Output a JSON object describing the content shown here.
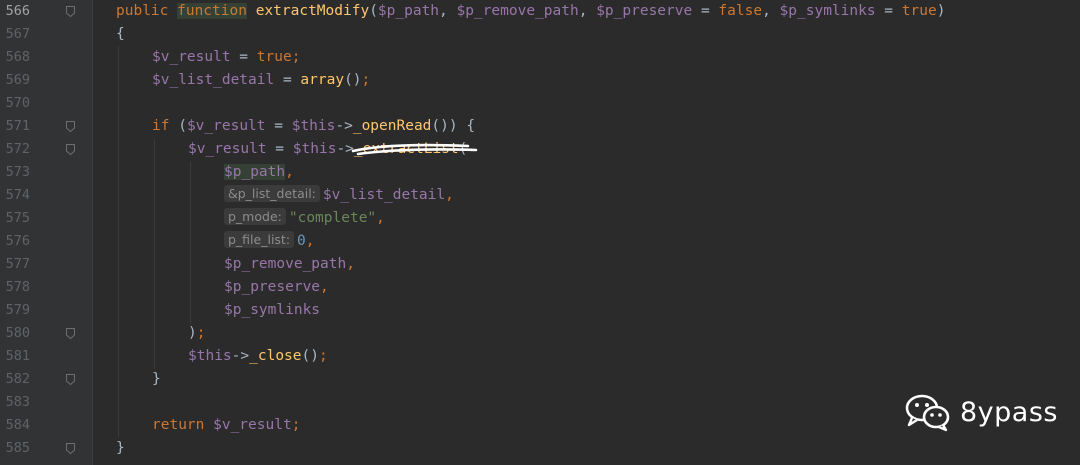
{
  "editor": {
    "lines": [
      {
        "no": "566",
        "current": true,
        "fold": true,
        "tokens": [
          [
            "kw",
            "public "
          ],
          [
            "kw hl",
            "function"
          ],
          [
            "pl",
            " "
          ],
          [
            "fn",
            "extractModify"
          ],
          [
            "pl",
            "("
          ],
          [
            "var",
            "$p_path"
          ],
          [
            "pl",
            ", "
          ],
          [
            "var",
            "$p_remove_path"
          ],
          [
            "pl",
            ", "
          ],
          [
            "var",
            "$p_preserve"
          ],
          [
            "pl",
            " = "
          ],
          [
            "kw",
            "false"
          ],
          [
            "pl",
            ", "
          ],
          [
            "var",
            "$p_symlinks"
          ],
          [
            "pl",
            " = "
          ],
          [
            "kw",
            "true"
          ],
          [
            "pl",
            ")"
          ]
        ],
        "indent": 0
      },
      {
        "no": "567",
        "tokens": [
          [
            "pl",
            "{"
          ]
        ],
        "indent": 0
      },
      {
        "no": "568",
        "tokens": [
          [
            "var",
            "$v_result"
          ],
          [
            "pl",
            " = "
          ],
          [
            "kw",
            "true"
          ],
          [
            "kw",
            ";"
          ]
        ],
        "indent": 1
      },
      {
        "no": "569",
        "tokens": [
          [
            "var",
            "$v_list_detail"
          ],
          [
            "pl",
            " = "
          ],
          [
            "fn",
            "array"
          ],
          [
            "pl",
            "()"
          ],
          [
            "kw",
            ";"
          ]
        ],
        "indent": 1
      },
      {
        "no": "570",
        "tokens": [],
        "indent": 0
      },
      {
        "no": "571",
        "fold": true,
        "tokens": [
          [
            "kw",
            "if "
          ],
          [
            "pl",
            "("
          ],
          [
            "var",
            "$v_result"
          ],
          [
            "pl",
            " = "
          ],
          [
            "var",
            "$this"
          ],
          [
            "pl",
            "->"
          ],
          [
            "fn",
            "_openRead"
          ],
          [
            "pl",
            "()) {"
          ]
        ],
        "indent": 1
      },
      {
        "no": "572",
        "fold": true,
        "tokens": [
          [
            "var",
            "$v_result"
          ],
          [
            "pl",
            " = "
          ],
          [
            "var",
            "$this"
          ],
          [
            "pl",
            "->"
          ],
          [
            "fn",
            "_extractList"
          ],
          [
            "pl",
            "("
          ]
        ],
        "indent": 2
      },
      {
        "no": "573",
        "tokens": [
          [
            "var hl",
            "$p_path"
          ],
          [
            "kw",
            ","
          ]
        ],
        "indent": 3
      },
      {
        "no": "574",
        "tokens": [
          [
            "hint",
            "&p_list_detail:"
          ],
          [
            "var",
            "$v_list_detail"
          ],
          [
            "kw",
            ","
          ]
        ],
        "indent": 3
      },
      {
        "no": "575",
        "tokens": [
          [
            "hint",
            "p_mode:"
          ],
          [
            "str",
            "\"complete\""
          ],
          [
            "kw",
            ","
          ]
        ],
        "indent": 3
      },
      {
        "no": "576",
        "tokens": [
          [
            "hint",
            "p_file_list:"
          ],
          [
            "num",
            "0"
          ],
          [
            "kw",
            ","
          ]
        ],
        "indent": 3
      },
      {
        "no": "577",
        "tokens": [
          [
            "var",
            "$p_remove_path"
          ],
          [
            "kw",
            ","
          ]
        ],
        "indent": 3
      },
      {
        "no": "578",
        "tokens": [
          [
            "var",
            "$p_preserve"
          ],
          [
            "kw",
            ","
          ]
        ],
        "indent": 3
      },
      {
        "no": "579",
        "tokens": [
          [
            "var",
            "$p_symlinks"
          ]
        ],
        "indent": 3
      },
      {
        "no": "580",
        "fold": true,
        "tokens": [
          [
            "pl",
            ")"
          ],
          [
            "kw",
            ";"
          ]
        ],
        "indent": 2
      },
      {
        "no": "581",
        "tokens": [
          [
            "var",
            "$this"
          ],
          [
            "pl",
            "->"
          ],
          [
            "fn",
            "_close"
          ],
          [
            "pl",
            "()"
          ],
          [
            "kw",
            ";"
          ]
        ],
        "indent": 2
      },
      {
        "no": "582",
        "fold": true,
        "tokens": [
          [
            "pl",
            "}"
          ]
        ],
        "indent": 1
      },
      {
        "no": "583",
        "tokens": [],
        "indent": 0
      },
      {
        "no": "584",
        "tokens": [
          [
            "kw",
            "return "
          ],
          [
            "var",
            "$v_result"
          ],
          [
            "kw",
            ";"
          ]
        ],
        "indent": 1
      },
      {
        "no": "585",
        "fold": true,
        "tokens": [
          [
            "pl",
            "}"
          ]
        ],
        "indent": 0
      }
    ]
  },
  "watermark": {
    "text": "8ypass",
    "icon": "wechat-icon"
  },
  "colors": {
    "background": "#2b2b2b",
    "keyword": "#cc7832",
    "variable": "#9876aa",
    "function": "#ffc66d",
    "string": "#6a8759",
    "number": "#6897bb"
  }
}
